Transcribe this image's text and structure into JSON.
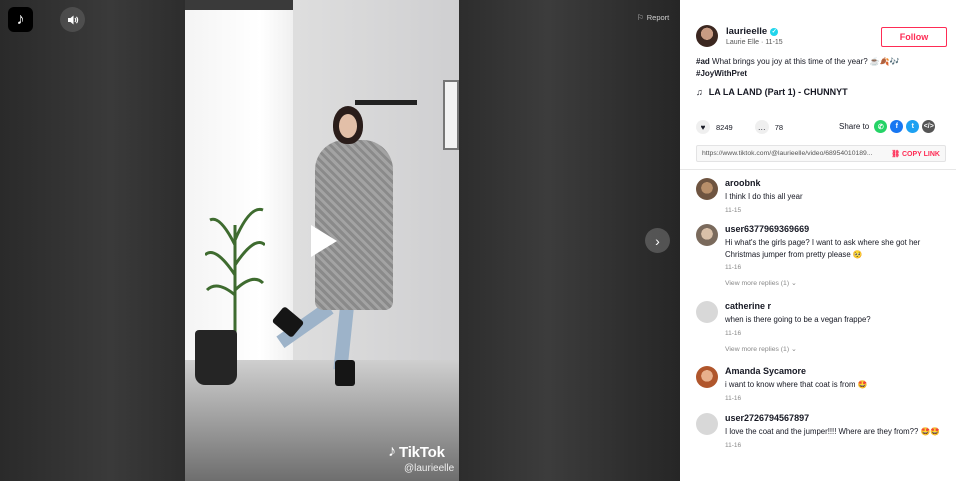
{
  "brand": {
    "app_logo": "tiktok-logo-icon"
  },
  "player": {
    "report_label": "Report",
    "watermark_brand": "TikTok",
    "watermark_user": "@laurieelle"
  },
  "author": {
    "name": "laurieelle",
    "display_name": "Laurie Elle",
    "date": "11-15",
    "follow_label": "Follow"
  },
  "caption": {
    "ad_tag": "#ad",
    "text": "What brings you joy at this time of the year? ☕️🍂🎶",
    "hashtag": "#JoyWithPret"
  },
  "music": {
    "title": "LA LA LAND (Part 1) - CHUNNYT"
  },
  "stats": {
    "likes": "8249",
    "comments": "78"
  },
  "share": {
    "label": "Share to"
  },
  "link": {
    "url": "https://www.tiktok.com/@laurieelle/video/68954010189...",
    "copy_label": "COPY LINK"
  },
  "comments": [
    {
      "user": "aroobnk",
      "text": "I think I do this all year",
      "date": "11-15",
      "more": ""
    },
    {
      "user": "user6377969369669",
      "text": "Hi what's the girls page? I want to ask where she got her Christmas jumper from pretty please 🥺",
      "date": "11-16",
      "more": "View more replies (1)"
    },
    {
      "user": "catherine r",
      "text": "when is there going to be a vegan frappe?",
      "date": "11-16",
      "more": "View more replies (1)"
    },
    {
      "user": "Amanda Sycamore",
      "text": "i want to know where that coat is from 🤩",
      "date": "11-16",
      "more": ""
    },
    {
      "user": "user2726794567897",
      "text": "I love the coat and the jumper!!!! Where are they from?? 🤩🤩",
      "date": "11-16",
      "more": ""
    }
  ],
  "colors": {
    "accent": "#fe2c55",
    "verified": "#20d5ec"
  }
}
